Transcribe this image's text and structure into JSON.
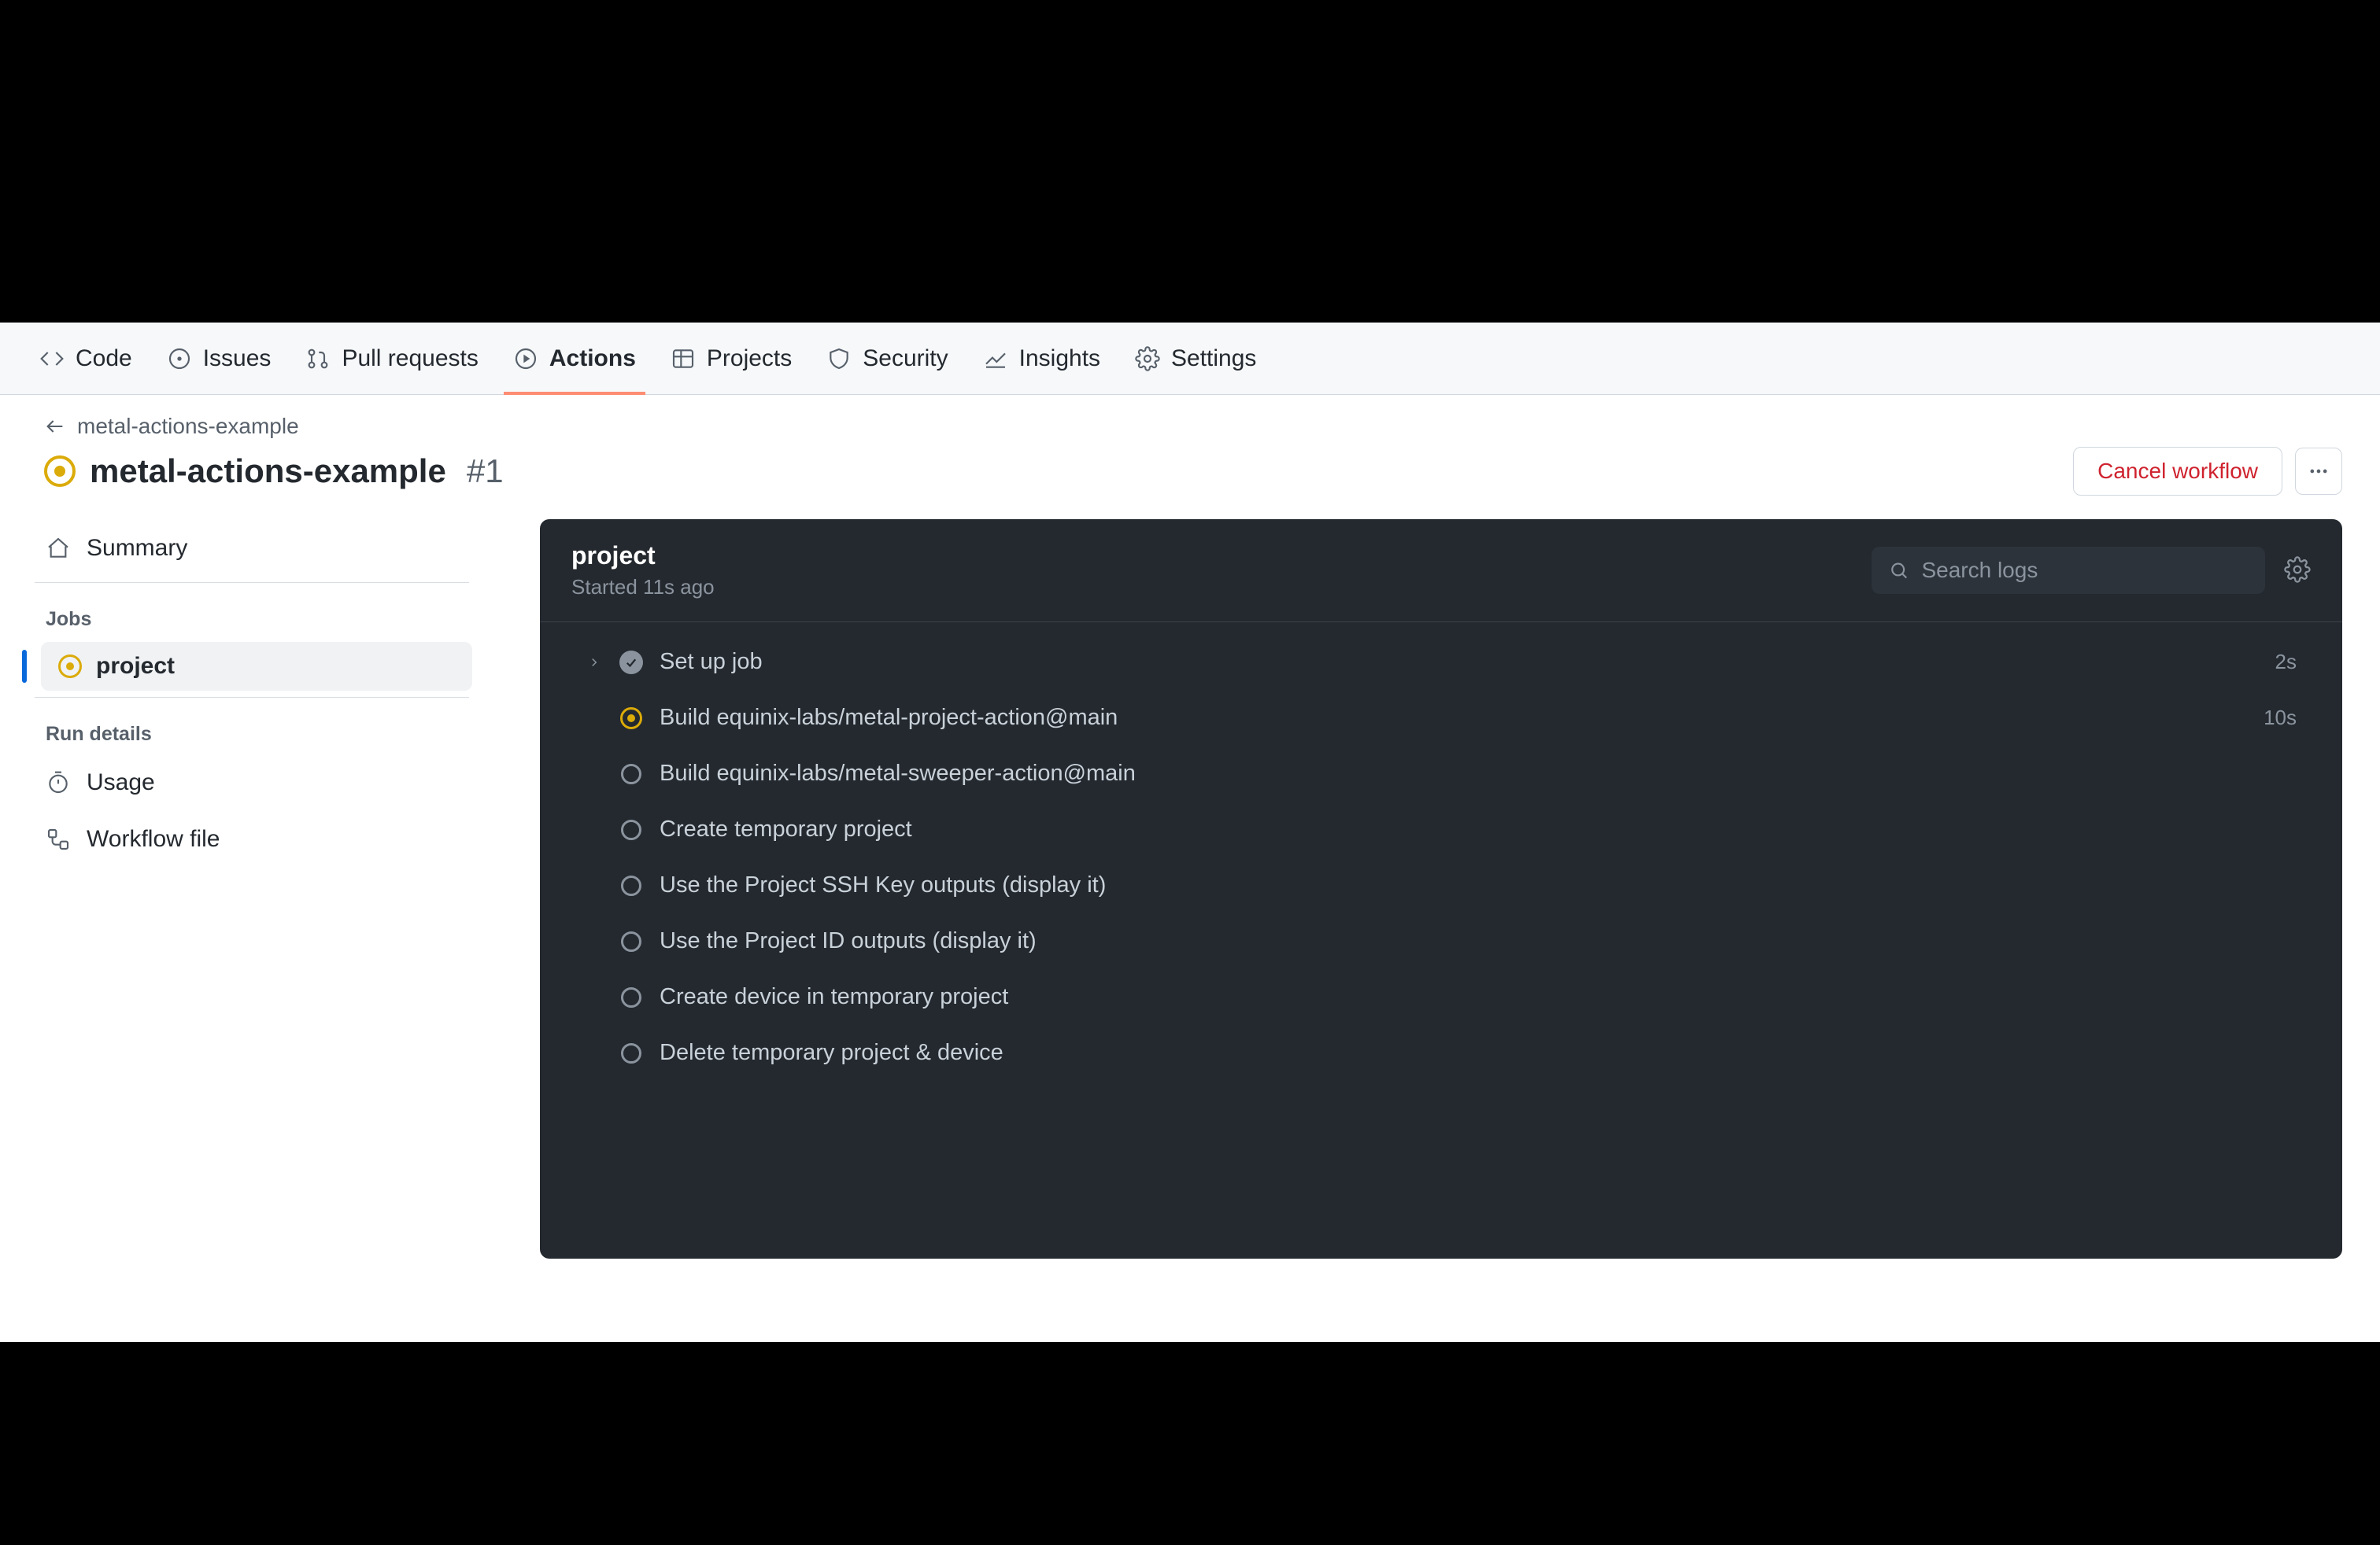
{
  "repo_tabs": {
    "code": "Code",
    "issues": "Issues",
    "pull_requests": "Pull requests",
    "actions": "Actions",
    "projects": "Projects",
    "security": "Security",
    "insights": "Insights",
    "settings": "Settings"
  },
  "breadcrumb": {
    "back_label": "metal-actions-example"
  },
  "header": {
    "workflow_name": "metal-actions-example",
    "run_number": "#1",
    "cancel_label": "Cancel workflow"
  },
  "sidebar": {
    "summary_label": "Summary",
    "jobs_heading": "Jobs",
    "jobs": [
      {
        "name": "project"
      }
    ],
    "run_details_heading": "Run details",
    "usage_label": "Usage",
    "workflow_file_label": "Workflow file"
  },
  "panel": {
    "title": "project",
    "subtitle": "Started 11s ago",
    "search_placeholder": "Search logs"
  },
  "steps": [
    {
      "label": "Set up job",
      "state": "success",
      "time": "2s",
      "expandable": true
    },
    {
      "label": "Build equinix-labs/metal-project-action@main",
      "state": "running",
      "time": "10s",
      "expandable": false
    },
    {
      "label": "Build equinix-labs/metal-sweeper-action@main",
      "state": "pending",
      "time": "",
      "expandable": false
    },
    {
      "label": "Create temporary project",
      "state": "pending",
      "time": "",
      "expandable": false
    },
    {
      "label": "Use the Project SSH Key outputs (display it)",
      "state": "pending",
      "time": "",
      "expandable": false
    },
    {
      "label": "Use the Project ID outputs (display it)",
      "state": "pending",
      "time": "",
      "expandable": false
    },
    {
      "label": "Create device in temporary project",
      "state": "pending",
      "time": "",
      "expandable": false
    },
    {
      "label": "Delete temporary project & device",
      "state": "pending",
      "time": "",
      "expandable": false
    }
  ]
}
